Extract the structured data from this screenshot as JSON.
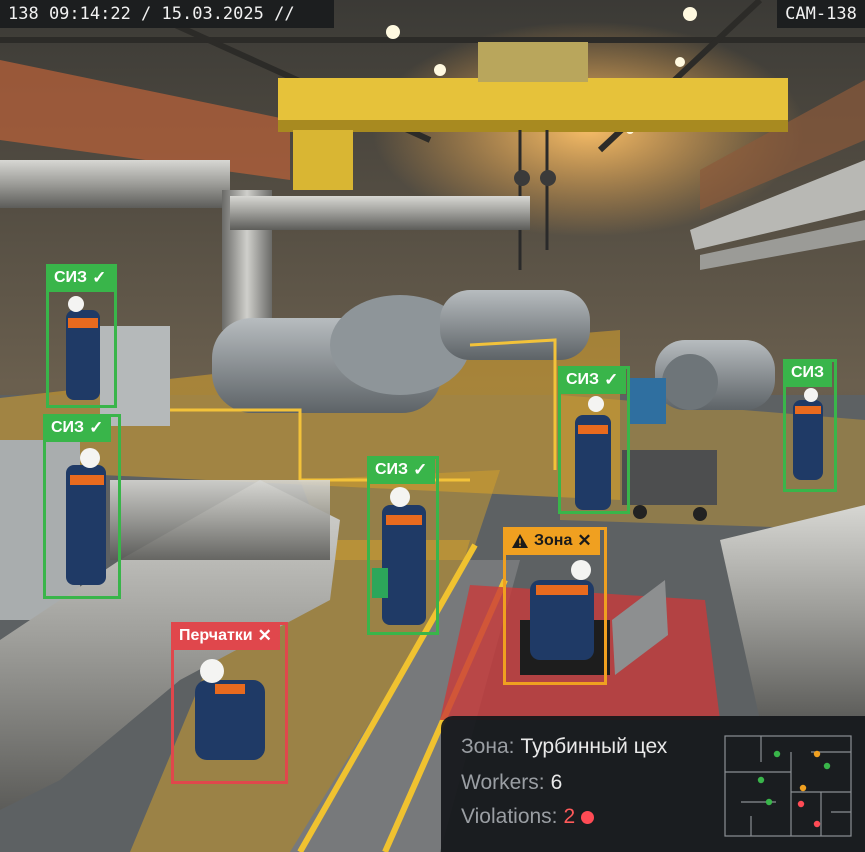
{
  "hud": {
    "timestamp": "138 09:14:22 / 15.03.2025 //",
    "camera": "CAM-138"
  },
  "detections": [
    {
      "label": "СИЗ",
      "status": "ok",
      "mark": "✓"
    },
    {
      "label": "СИЗ",
      "status": "ok",
      "mark": "✓"
    },
    {
      "label": "СИЗ",
      "status": "ok",
      "mark": "✓"
    },
    {
      "label": "СИЗ",
      "status": "ok",
      "mark": "✓"
    },
    {
      "label": "СИЗ",
      "status": "ok",
      "mark": ""
    },
    {
      "label": "Зона",
      "status": "warning",
      "mark": "✕",
      "icon": "warning-triangle-icon"
    },
    {
      "label": "Перчатки",
      "status": "violation",
      "mark": "✕"
    }
  ],
  "panel": {
    "zone_key": "Зона:",
    "zone_value": "Турбинный цех",
    "workers_key": "Workers:",
    "workers_value": "6",
    "violations_key": "Violations:",
    "violations_value": "2"
  },
  "colors": {
    "ok": "#39b54a",
    "violation": "#e0474c",
    "warning": "#f0a020",
    "safety_zone": "#d9a32a",
    "danger_zone": "#c93b3b"
  }
}
